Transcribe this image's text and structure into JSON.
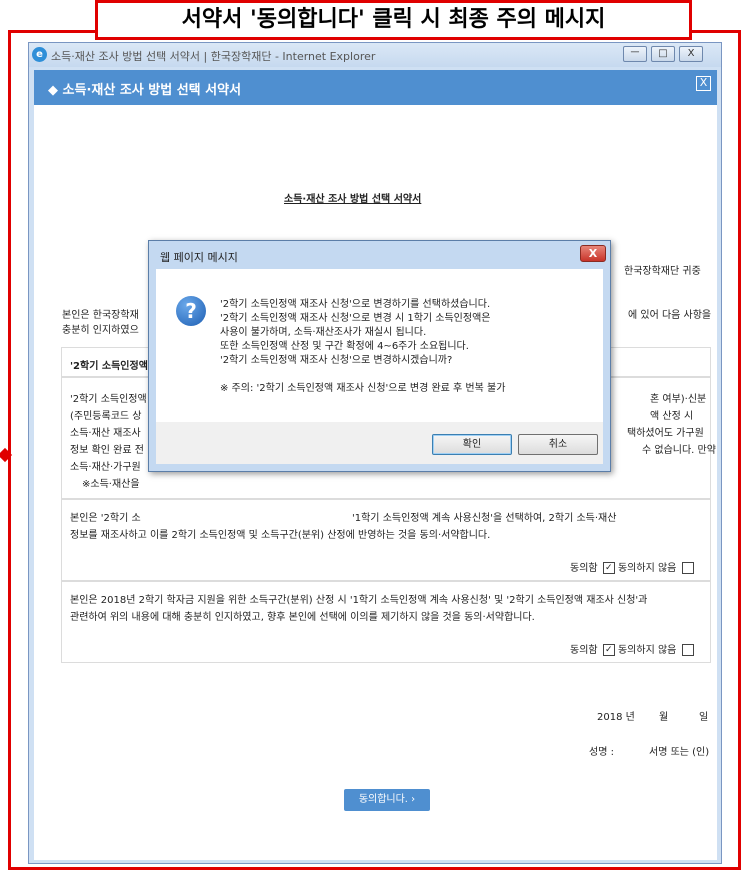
{
  "banner_text": "서약서 '동의합니다' 클릭 시 최종 주의 메시지",
  "ie_window": {
    "title": "소득·재산 조사 방법 선택 서약서 | 한국장학재단 - Internet Explorer",
    "buttons": [
      "ㅡ",
      "□",
      "X"
    ]
  },
  "popup": {
    "title": "◆ 소득·재산 조사 방법 선택 서약서",
    "close_label": "X"
  },
  "doc": {
    "title": "소득·재산 조사 방법 선택 서약서",
    "addressee": "한국장학재단 귀중",
    "intro_left": "본인은 한국장학재",
    "intro_right": "에 있어 다음 사항을",
    "intro_line2": "충분히 인지하였으",
    "section1_header": "'2학기 소득인정액",
    "body_left": [
      "'2학기 소득인정액",
      "(주민등록코드 상",
      "소득·재산 재조사",
      "정보 확인 완료 전",
      "소득·재산·가구원",
      "※소득·재산을"
    ],
    "body_right": [
      "혼 여부)·신분",
      "액 산정 시",
      "택하셨어도 가구원",
      "수 없습니다. 만약"
    ],
    "consent1": [
      "본인은 '2학기 소",
      "'1학기 소득인정액 계속 사용신청'을 선택하여, 2학기 소득·재산",
      "정보를 재조사하고 이를 2학기 소득인정액 및 소득구간(분위) 산정에 반영하는 것을 동의·서약합니다."
    ],
    "consent2": [
      "본인은 2018년 2학기 학자금 지원을 위한 소득구간(분위) 산정 시 '1학기 소득인정액 계속 사용신청' 및 '2학기 소득인정액 재조사 신청'과",
      "관련하여 위의 내용에 대해 충분히 인지하였고, 향후 본인에 선택에 이의를 제기하지 않을 것을 동의·서약합니다."
    ],
    "agree_label": "동의함",
    "disagree_label": "동의하지 않음",
    "check_mark": "✓",
    "year": "2018 년",
    "month": "월",
    "day": "일",
    "sign_label": "성명 :",
    "sign_value": "서명 또는 (인)",
    "submit_label": "동의합니다. ›"
  },
  "dialog": {
    "title": "웹 페이지 메시지",
    "close_label": "X",
    "icon": "?",
    "lines": [
      "'2학기 소득인정액 재조사 신청'으로 변경하기를 선택하셨습니다.",
      "'2학기 소득인정액 재조사 신청'으로 변경 시 1학기 소득인정액은",
      "사용이 불가하며, 소득·재산조사가 재실시 됩니다.",
      "또한 소득인정액 산정 및 구간 확정에 4~6주가 소요됩니다.",
      "'2학기 소득인정액 재조사 신청'으로 변경하시겠습니까?"
    ],
    "warning": "※ 주의: '2학기 소득인정액 재조사 신청'으로 변경 완료 후 번복 불가",
    "ok_label": "확인",
    "cancel_label": "취소"
  }
}
